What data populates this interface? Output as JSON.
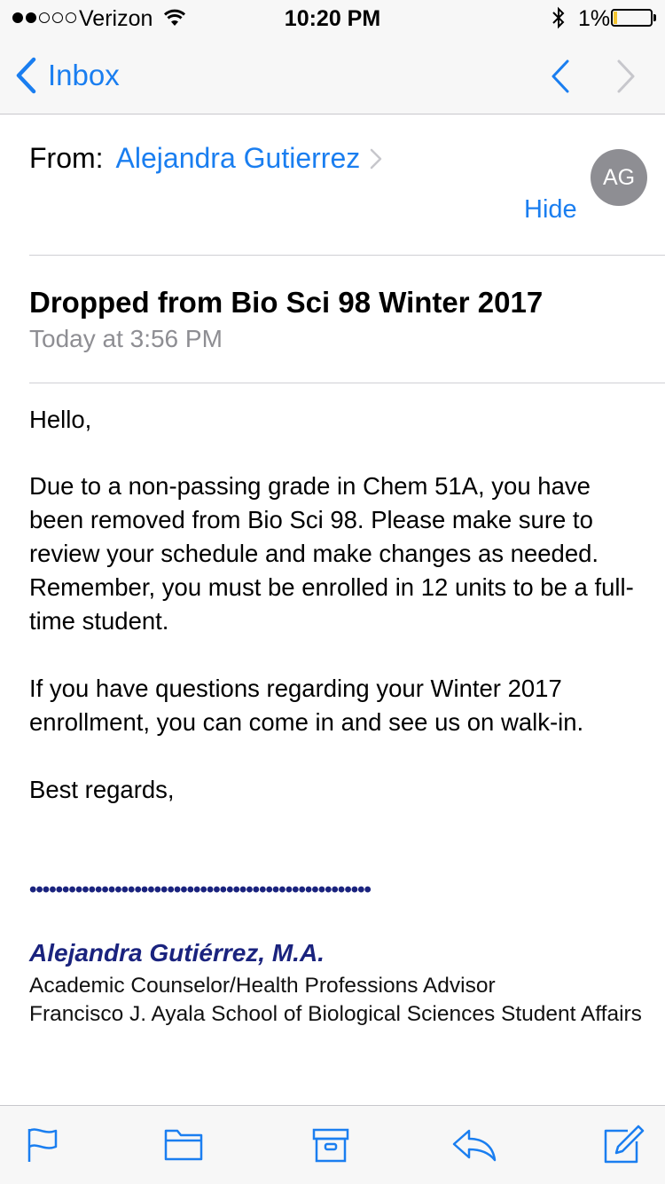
{
  "status_bar": {
    "carrier": "Verizon",
    "time": "10:20 PM",
    "battery": "1%",
    "signal_bars": 2,
    "battery_level": 0.01
  },
  "nav": {
    "back_label": "Inbox"
  },
  "header": {
    "from_label": "From:",
    "from_name": "Alejandra Gutierrez",
    "avatar_initials": "AG",
    "hide_label": "Hide",
    "subject": "Dropped from Bio Sci 98 Winter 2017",
    "date": "Today at 3:56 PM"
  },
  "body": {
    "greeting": "Hello,",
    "paragraph_1": "Due to a non-passing grade in Chem 51A, you have been removed from Bio Sci 98. Please make sure to review your schedule and make changes as needed.  Remember, you must be enrolled in 12 units to be a full-time student.",
    "paragraph_2": "If you have questions regarding your Winter 2017 enrollment, you can come in and see us on walk-in.",
    "closing": "Best regards,"
  },
  "signature": {
    "dots": "••••••••••••••••••••••••••••••••••••••••••••••••••••",
    "name": "Alejandra Gutiérrez, M.A.",
    "title": "Academic Counselor/Health Professions Advisor",
    "org": "Francisco J. Ayala School of Biological Sciences Student Affairs"
  },
  "toolbar": {
    "icons": [
      "flag-icon",
      "folder-icon",
      "archive-icon",
      "reply-icon",
      "compose-icon"
    ]
  },
  "colors": {
    "accent": "#1a7ef0",
    "signature_blue": "#1a237e",
    "secondary_text": "#8e8e93",
    "avatar_bg": "#8e8e93",
    "battery_fill": "#f4c531"
  }
}
